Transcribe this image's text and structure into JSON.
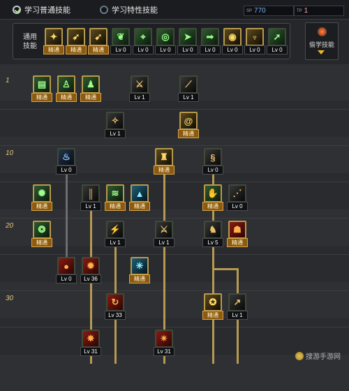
{
  "tabs": [
    {
      "label": "学习普通技能",
      "selected": true
    },
    {
      "label": "学习特性技能",
      "selected": false
    }
  ],
  "points": [
    {
      "tag": "SP",
      "value": "770",
      "color": "#79aefb"
    },
    {
      "tag": "TP",
      "value": "1",
      "color": "#f0a7a7"
    }
  ],
  "general": {
    "label": "通用\n技能",
    "skills": [
      {
        "icon": "kick-icon",
        "theme": "gold",
        "badge": "精通"
      },
      {
        "icon": "leap-icon",
        "theme": "gold",
        "badge": "精通"
      },
      {
        "icon": "runner-icon",
        "theme": "gold",
        "badge": "精通"
      },
      {
        "icon": "wings-icon",
        "theme": "green",
        "badge": "Lv 0"
      },
      {
        "icon": "crosshair-icon",
        "theme": "green",
        "badge": "Lv 0"
      },
      {
        "icon": "target-icon",
        "theme": "green",
        "badge": "Lv 0"
      },
      {
        "icon": "dash-icon",
        "theme": "green",
        "badge": "Lv 0"
      },
      {
        "icon": "sprint-icon",
        "theme": "green",
        "badge": "Lv 0"
      },
      {
        "icon": "coin-icon",
        "theme": "gold",
        "badge": "Lv 0"
      },
      {
        "icon": "muscle-icon",
        "theme": "gold",
        "badge": "Lv 0"
      },
      {
        "icon": "rush-icon",
        "theme": "green",
        "badge": "Lv 0"
      }
    ]
  },
  "steal_label": "偷学技能",
  "levels": [
    "1",
    "10",
    "20",
    "30"
  ],
  "tree": [
    {
      "id": "s1",
      "icon": "scroll-icon",
      "theme": "green",
      "badge": "精通"
    },
    {
      "id": "s2",
      "icon": "walker-icon",
      "theme": "green",
      "badge": "精通"
    },
    {
      "id": "s3",
      "icon": "figure-icon",
      "theme": "green",
      "badge": "精通"
    },
    {
      "id": "s4",
      "icon": "slash-icon",
      "theme": "black",
      "badge": "Lv 1"
    },
    {
      "id": "s5",
      "icon": "blade-icon",
      "theme": "black",
      "badge": "Lv 1"
    },
    {
      "id": "s6",
      "icon": "stance-icon",
      "theme": "black",
      "badge": "Lv 1"
    },
    {
      "id": "s7",
      "icon": "spiral-icon",
      "theme": "gold",
      "badge": "精通"
    },
    {
      "id": "s8",
      "icon": "flame-icon",
      "theme": "blue",
      "badge": "Lv 0"
    },
    {
      "id": "s9",
      "icon": "warrior-icon",
      "theme": "gold",
      "badge": "精通"
    },
    {
      "id": "s10",
      "icon": "dragon-icon",
      "theme": "black",
      "badge": "Lv 0"
    },
    {
      "id": "s11",
      "icon": "burst-icon",
      "theme": "green",
      "badge": "精通"
    },
    {
      "id": "s12",
      "icon": "pillar-icon",
      "theme": "black",
      "badge": "Lv 1"
    },
    {
      "id": "s13",
      "icon": "wave-icon",
      "theme": "green",
      "badge": "精通"
    },
    {
      "id": "s14",
      "icon": "mountain-icon",
      "theme": "cyan",
      "badge": "精通"
    },
    {
      "id": "s15",
      "icon": "hand-icon",
      "theme": "green",
      "badge": "精通"
    },
    {
      "id": "s16",
      "icon": "claw-icon",
      "theme": "black",
      "badge": "Lv 0"
    },
    {
      "id": "s17",
      "icon": "beast-icon",
      "theme": "green",
      "badge": "精通"
    },
    {
      "id": "s18",
      "icon": "strike-icon",
      "theme": "black",
      "badge": "Lv 1"
    },
    {
      "id": "s19",
      "icon": "duel-icon",
      "theme": "black",
      "badge": "Lv 1"
    },
    {
      "id": "s20",
      "icon": "fighter-icon",
      "theme": "black",
      "badge": "Lv 5"
    },
    {
      "id": "s21",
      "icon": "mask-icon",
      "theme": "red",
      "badge": "精通"
    },
    {
      "id": "s22",
      "icon": "orb-icon",
      "theme": "red",
      "badge": "Lv 0"
    },
    {
      "id": "s23",
      "icon": "fury-icon",
      "theme": "red",
      "badge": "Lv 36"
    },
    {
      "id": "s24",
      "icon": "shatter-icon",
      "theme": "cyan",
      "badge": "精通"
    },
    {
      "id": "s25",
      "icon": "whirl-icon",
      "theme": "red",
      "badge": "Lv 33"
    },
    {
      "id": "s26",
      "icon": "tiger-icon",
      "theme": "gold",
      "badge": "精通"
    },
    {
      "id": "s27",
      "icon": "spear-icon",
      "theme": "black",
      "badge": "Lv 1"
    },
    {
      "id": "s28",
      "icon": "inferno-icon",
      "theme": "red",
      "badge": "Lv 31"
    },
    {
      "id": "s29",
      "icon": "blast-icon",
      "theme": "red",
      "badge": "Lv 31"
    }
  ],
  "watermark": "搜游手游网"
}
